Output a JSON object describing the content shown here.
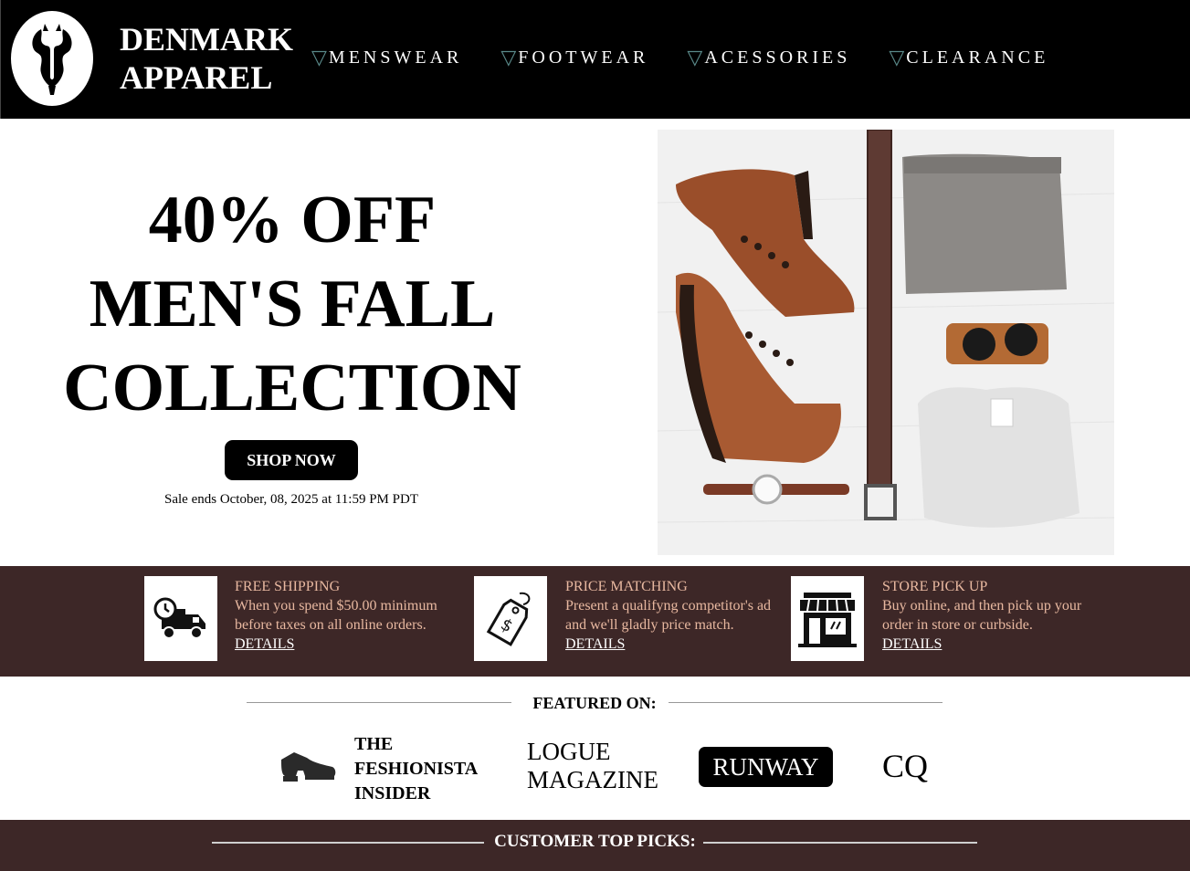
{
  "header": {
    "brand_line1": "DENMARK",
    "brand_line2": "APPAREL",
    "nav": [
      {
        "label": "MENSWEAR"
      },
      {
        "label": "FOOTWEAR"
      },
      {
        "label": "ACESSORIES"
      },
      {
        "label": "CLEARANCE"
      }
    ],
    "nav_marker": "▽"
  },
  "hero": {
    "line1": "40% OFF",
    "line2": "MEN'S FALL",
    "line3": "COLLECTION",
    "button": "SHOP NOW",
    "sale_ends": "Sale ends October, 08, 2025 at 11:59 PM PDT"
  },
  "benefits": [
    {
      "icon": "delivery-truck-clock-icon",
      "title": "FREE SHIPPING",
      "desc": "When you spend $50.00 minimum before taxes on all online orders.",
      "link": "DETAILS"
    },
    {
      "icon": "price-tag-icon",
      "title": "PRICE MATCHING",
      "desc": "Present a qualifyng competitor's ad and we'll gladly price match.",
      "link": "DETAILS"
    },
    {
      "icon": "storefront-icon",
      "title": "STORE PICK UP",
      "desc": "Buy online, and then pick up your order in store or curbside.",
      "link": "DETAILS"
    }
  ],
  "featured": {
    "heading": "FEATURED ON:",
    "fesh_1": "THE",
    "fesh_2": "FESHIONISTA",
    "fesh_3": "INSIDER",
    "logue_1": "LOGUE",
    "logue_2": "MAGAZINE",
    "runway": "RUNWAY",
    "cq": "CQ"
  },
  "top_picks": {
    "heading": "CUSTOMER TOP PICKS:"
  },
  "colors": {
    "header_bg": "#000000",
    "band_bg": "#3d2727",
    "benefit_text": "#e8b8a0",
    "nav_marker": "#5a8a8a"
  }
}
